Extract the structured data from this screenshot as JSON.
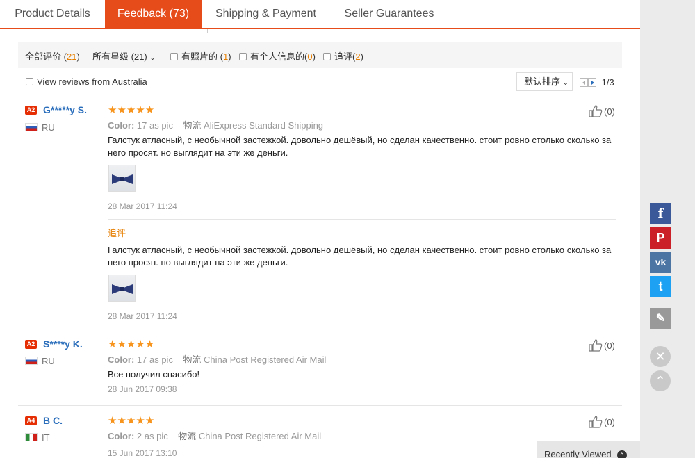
{
  "tabs": [
    {
      "label": "Product Details",
      "active": false
    },
    {
      "label": "Feedback (73)",
      "active": true
    },
    {
      "label": "Shipping & Payment",
      "active": false
    },
    {
      "label": "Seller Guarantees",
      "active": false
    }
  ],
  "filters": {
    "all_label": "全部评价",
    "all_count": "21",
    "stars_label": "所有星级",
    "stars_count": "(21)",
    "photos_label": "有照片的",
    "photos_count": "1",
    "personal_label": "有个人信息的",
    "personal_count": "0",
    "followup_label": "追评",
    "followup_count": "2"
  },
  "australia_label": "View reviews from Australia",
  "sort_label": "默认排序",
  "pager": "1/3",
  "reviews": [
    {
      "level": "A2",
      "name": "G*****y S.",
      "country": "RU",
      "color_label": "Color:",
      "color_value": "17 as pic",
      "shipping_label": "物流",
      "shipping_value": "AliExpress Standard Shipping",
      "text": "Галстук атласный, с необычной застежкой. довольно дешёвый, но сделан качественно. стоит ровно столько сколько за него просят. но выглядит на эти же деньги.",
      "date": "28 Mar 2017 11:24",
      "likes": "(0)",
      "followup_label": "追评",
      "followup_text": "Галстук атласный, с необычной застежкой. довольно дешёвый, но сделан качественно. стоит ровно столько сколько за него просят. но выглядит на эти же деньги.",
      "followup_date": "28 Mar 2017 11:24"
    },
    {
      "level": "A2",
      "name": "S****y K.",
      "country": "RU",
      "color_label": "Color:",
      "color_value": "17 as pic",
      "shipping_label": "物流",
      "shipping_value": "China Post Registered Air Mail",
      "text": "Все получил спасибо!",
      "date": "28 Jun 2017 09:38",
      "likes": "(0)"
    },
    {
      "level": "A4",
      "name": "B C.",
      "country": "IT",
      "color_label": "Color:",
      "color_value": "2 as pic",
      "shipping_label": "物流",
      "shipping_value": "China Post Registered Air Mail",
      "date": "15 Jun 2017 13:10",
      "likes": "(0)"
    }
  ],
  "rating_stars": "★★★★★",
  "sidebar": {
    "facebook": "f",
    "pinterest": "P",
    "vk": "vk",
    "twitter": "t",
    "edit": "✎",
    "close": "✕",
    "top": "⌃"
  },
  "recently_viewed": "Recently Viewed",
  "colors": {
    "accent": "#e64b1a",
    "link": "#2a6ebb",
    "star": "#f7941d",
    "facebook": "#3b5998",
    "pinterest": "#cb2027",
    "vk": "#4c75a3",
    "twitter": "#1da1f2"
  }
}
